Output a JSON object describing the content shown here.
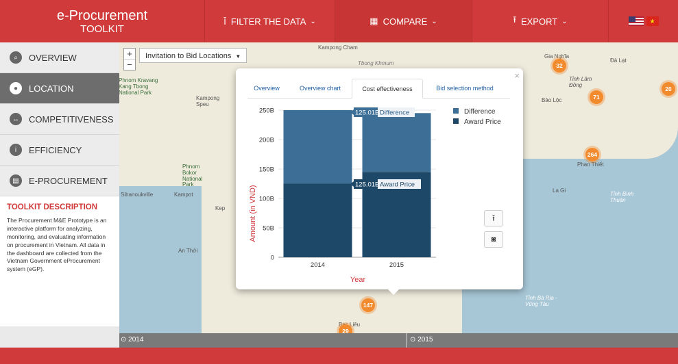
{
  "header": {
    "title": "e-Procurement",
    "subtitle": "TOOLKIT",
    "filter_label": "FILTER THE DATA",
    "compare_label": "COMPARE",
    "export_label": "EXPORT"
  },
  "sidebar": {
    "items": [
      {
        "label": "OVERVIEW",
        "icon": "search-icon"
      },
      {
        "label": "LOCATION",
        "icon": "map-pin-icon"
      },
      {
        "label": "COMPETITIVENESS",
        "icon": "arrows-icon"
      },
      {
        "label": "EFFICIENCY",
        "icon": "info-icon"
      },
      {
        "label": "E-PROCUREMENT",
        "icon": "document-icon"
      }
    ],
    "description_title": "TOOLKIT DESCRIPTION",
    "description_text": "The Procurement M&E Prototype is an interactive platform for analyzing, monitoring, and evaluating information on procurement in Vietnam. All data in the dashboard are collected from the Vietnam Government eProcurement system (eGP)."
  },
  "map": {
    "layer_select": "Invitation to Bid Locations",
    "zoom_in": "+",
    "zoom_out": "−",
    "clusters": [
      "32",
      "20",
      "71",
      "264",
      "147",
      "29"
    ],
    "labels": [
      "Kampong Cham",
      "Phnom Kravang Kang Tbong National Park",
      "Kampong Speu",
      "Sihanoukville",
      "Kampot",
      "Kep",
      "An Thới",
      "Gia Nghĩa",
      "Đà Lạt",
      "Tỉnh Lâm Đồng",
      "Bảo Lộc",
      "Phan Thiết",
      "La Gi",
      "Tỉnh Bình Thuận",
      "Tỉnh Bà Rịa - Vũng Tàu",
      "Bạc Liêu",
      "Tbong Khmum",
      "Phnom Bokor National Park"
    ]
  },
  "timeline": {
    "left": "2014",
    "right": "2015"
  },
  "modal": {
    "close": "×",
    "tabs": [
      "Overview",
      "Overview chart",
      "Cost effectiveness",
      "Bid selection method"
    ],
    "active_tab": "Cost effectiveness",
    "tooltip_difference": "125.01B",
    "tooltip_difference_label": "Difference",
    "tooltip_award": "125.01B",
    "tooltip_award_label": "Award Price"
  },
  "colors": {
    "brand_red": "#d03a3a",
    "difference": "#3d6e95",
    "award_price": "#1e4868",
    "cluster": "#f28a2e"
  },
  "chart_data": {
    "type": "bar",
    "stacked": true,
    "categories": [
      "2014",
      "2015"
    ],
    "series": [
      {
        "name": "Award Price",
        "values": [
          125.01,
          145
        ],
        "color": "#1e4868"
      },
      {
        "name": "Difference",
        "values": [
          125.01,
          100
        ],
        "color": "#3d6e95"
      }
    ],
    "ylabel": "Amount (in VND)",
    "xlabel": "Year",
    "yticks": [
      "0",
      "50B",
      "100B",
      "150B",
      "200B",
      "250B"
    ],
    "ylim": [
      0,
      250
    ],
    "legend": "top-right"
  }
}
